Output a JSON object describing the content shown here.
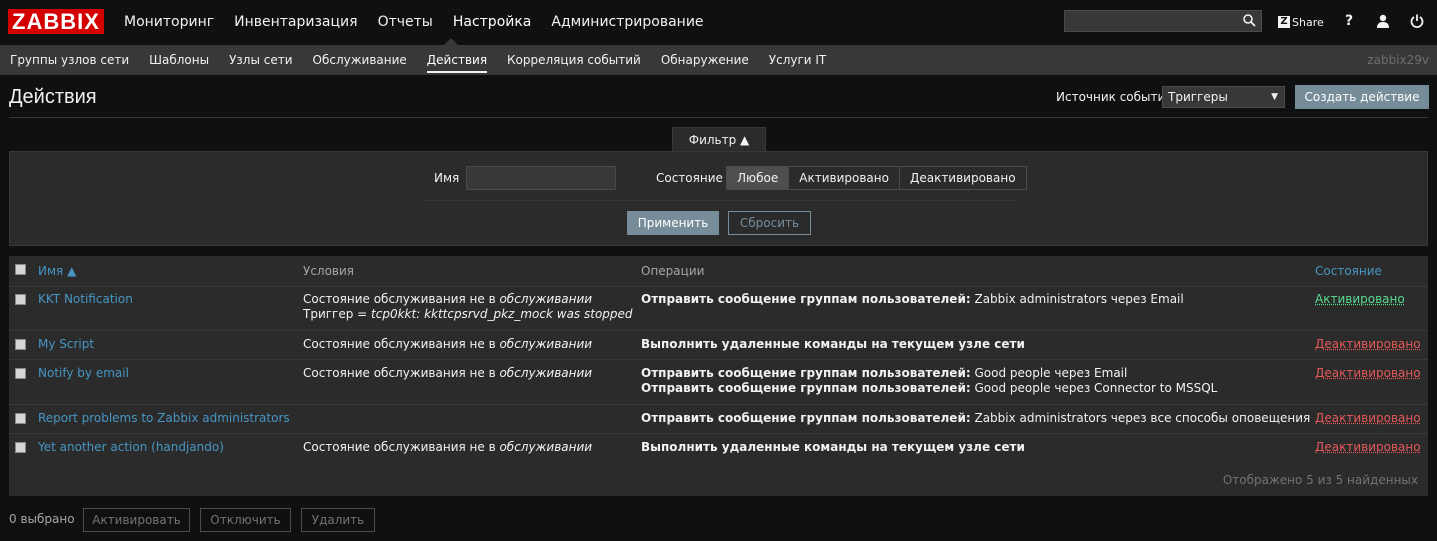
{
  "logo": "ZABBIX",
  "main_menu": [
    "Мониторинг",
    "Инвентаризация",
    "Отчеты",
    "Настройка",
    "Администрирование"
  ],
  "header_tools": {
    "share_label": "Share",
    "help": "?"
  },
  "icons": {
    "search": "search-icon",
    "share": "share-icon",
    "help": "help-icon",
    "user": "user-icon",
    "power": "logout-icon"
  },
  "sub_menu": [
    "Группы узлов сети",
    "Шаблоны",
    "Узлы сети",
    "Обслуживание",
    "Действия",
    "Корреляция событий",
    "Обнаружение",
    "Услуги IT"
  ],
  "server_name": "zabbix29v",
  "page": {
    "title": "Действия",
    "source_label": "Источник событий",
    "source_value": "Триггеры",
    "create_button": "Создать действие"
  },
  "filter": {
    "tab_label": "Фильтр ▲",
    "name_label": "Имя",
    "name_value": "",
    "state_label": "Состояние",
    "state_options": [
      "Любое",
      "Активировано",
      "Деактивировано"
    ],
    "state_selected": "Любое",
    "apply": "Применить",
    "reset": "Сбросить"
  },
  "table": {
    "headers": {
      "name": "Имя ▲",
      "conditions": "Условия",
      "operations": "Операции",
      "status": "Состояние"
    },
    "rows": [
      {
        "name": "KKT Notification",
        "conditions": [
          {
            "plain": "Состояние обслуживания не в ",
            "italic": "обслуживании"
          },
          {
            "plain": "Триггер = ",
            "italic": "tcp0kkt: kkttcpsrvd_pkz_mock was stopped"
          }
        ],
        "operations": [
          {
            "bold": "Отправить сообщение группам пользователей:",
            "text": " Zabbix administrators через Email"
          }
        ],
        "status": "Активировано"
      },
      {
        "name": "My Script",
        "conditions": [
          {
            "plain": "Состояние обслуживания не в ",
            "italic": "обслуживании"
          }
        ],
        "operations": [
          {
            "bold": "Выполнить удаленные команды на текущем узле сети",
            "text": ""
          }
        ],
        "status": "Деактивировано"
      },
      {
        "name": "Notify by email",
        "conditions": [
          {
            "plain": "Состояние обслуживания не в ",
            "italic": "обслуживании"
          }
        ],
        "operations": [
          {
            "bold": "Отправить сообщение группам пользователей:",
            "text": " Good people через Email"
          },
          {
            "bold": "Отправить сообщение группам пользователей:",
            "text": " Good people через Connector to MSSQL"
          }
        ],
        "status": "Деактивировано"
      },
      {
        "name": "Report problems to Zabbix administrators",
        "conditions": [],
        "operations": [
          {
            "bold": "Отправить сообщение группам пользователей:",
            "text": " Zabbix administrators через все способы оповещения"
          }
        ],
        "status": "Деактивировано"
      },
      {
        "name": "Yet another action (handjando)",
        "conditions": [
          {
            "plain": "Состояние обслуживания не в ",
            "italic": "обслуживании"
          }
        ],
        "operations": [
          {
            "bold": "Выполнить удаленные команды на текущем узле сети",
            "text": ""
          }
        ],
        "status": "Деактивировано"
      }
    ],
    "footer": "Отображено 5 из 5 найденных"
  },
  "mass_actions": {
    "selected": "0 выбрано",
    "enable": "Активировать",
    "disable": "Отключить",
    "delete": "Удалить"
  },
  "colors": {
    "brand": "#d40000",
    "link": "#4796c4",
    "enabled": "#59db8f",
    "disabled": "#e45959",
    "button": "#768d99"
  }
}
